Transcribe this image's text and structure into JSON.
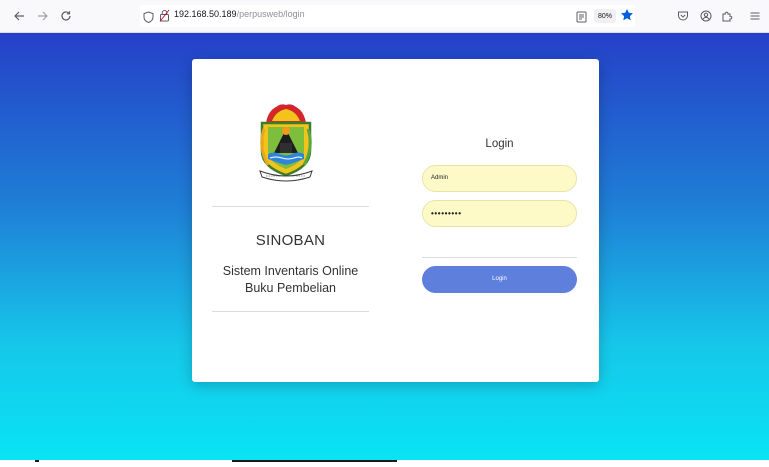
{
  "browser": {
    "url_host": "192.168.50.189",
    "url_path": "/perpusweb/login",
    "zoom": "80%"
  },
  "app": {
    "name": "SINOBAN",
    "description_line1": "Sistem Inventaris Online",
    "description_line2": "Buku Pembelian"
  },
  "login": {
    "title": "Login",
    "username_value": "Admin",
    "password_value": "•••••••••",
    "button_label": "Login"
  },
  "colors": {
    "accent_button": "#5f7fdd",
    "field_background": "#fdfac8",
    "bg_top": "#2540c8",
    "bg_bottom": "#08e6f5",
    "bookmark_star": "#0061e0"
  },
  "icons": {
    "back": "arrow-left-icon",
    "forward": "arrow-right-icon",
    "reload": "reload-icon",
    "shield": "tracking-shield-icon",
    "lock": "lock-icon",
    "reader": "reader-view-icon",
    "star": "bookmark-star-icon",
    "pocket": "pocket-icon",
    "account": "account-icon",
    "extensions": "extensions-icon",
    "menu": "hamburger-menu-icon"
  }
}
